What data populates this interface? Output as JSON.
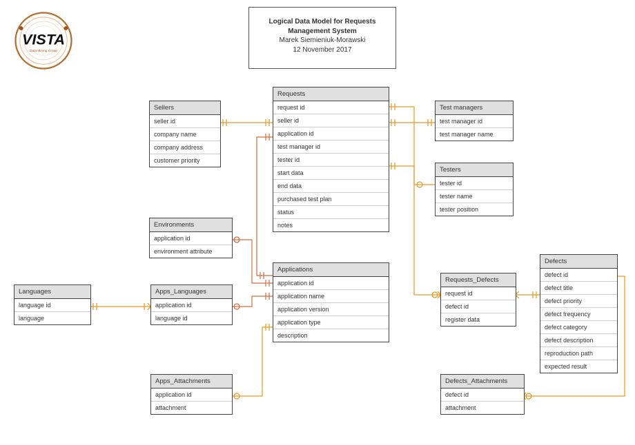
{
  "title": {
    "line1": "Logical Data Model for Requests",
    "line2": "Management System",
    "line3": "Marek Siemieniuk-Morawski",
    "line4": "12 November 2017"
  },
  "logo": {
    "text": "VISTA",
    "sub": "Data Mining Group"
  },
  "entities": {
    "sellers": {
      "name": "Sellers",
      "rows": [
        "seller id",
        "company name",
        "company address",
        "customer priority"
      ]
    },
    "requests": {
      "name": "Requests",
      "rows": [
        "request id",
        "seller id",
        "application id",
        "test manager id",
        "tester id",
        "start data",
        "end data",
        "purchased test plan",
        "status",
        "notes"
      ]
    },
    "test_managers": {
      "name": "Test managers",
      "rows": [
        "test manager id",
        "test manager name"
      ]
    },
    "testers": {
      "name": "Testers",
      "rows": [
        "tester id",
        "tester name",
        "tester position"
      ]
    },
    "environments": {
      "name": "Environments",
      "rows": [
        "application id",
        "environment attribute"
      ]
    },
    "applications": {
      "name": "Applications",
      "rows": [
        "application id",
        "application name",
        "application version",
        "application type",
        "description"
      ]
    },
    "requests_defects": {
      "name": "Requests_Defects",
      "rows": [
        "request id",
        "defect id",
        "register data"
      ]
    },
    "defects": {
      "name": "Defects",
      "rows": [
        "defect id",
        "defect title",
        "defect priority",
        "defect frequency",
        "defect category",
        "defect description",
        "reproduction path",
        "expected result"
      ]
    },
    "languages": {
      "name": "Languages",
      "rows": [
        "language id",
        "language"
      ]
    },
    "apps_languages": {
      "name": "Apps_Languages",
      "rows": [
        "application id",
        "language id"
      ]
    },
    "apps_attachments": {
      "name": "Apps_Attachments",
      "rows": [
        "application id",
        "attachment"
      ]
    },
    "defects_attachments": {
      "name": "Defects_Attachments",
      "rows": [
        "defect id",
        "attachment"
      ]
    }
  },
  "relationships": [
    {
      "from": "Sellers",
      "to": "Requests",
      "via": "seller id"
    },
    {
      "from": "Applications",
      "to": "Requests",
      "via": "application id"
    },
    {
      "from": "Test managers",
      "to": "Requests",
      "via": "test manager id"
    },
    {
      "from": "Testers",
      "to": "Requests",
      "via": "tester id"
    },
    {
      "from": "Environments",
      "to": "Applications",
      "via": "application id"
    },
    {
      "from": "Apps_Languages",
      "to": "Applications",
      "via": "application id"
    },
    {
      "from": "Languages",
      "to": "Apps_Languages",
      "via": "language id"
    },
    {
      "from": "Apps_Attachments",
      "to": "Applications",
      "via": "application id"
    },
    {
      "from": "Requests",
      "to": "Requests_Defects",
      "via": "request id"
    },
    {
      "from": "Defects",
      "to": "Requests_Defects",
      "via": "defect id"
    },
    {
      "from": "Defects",
      "to": "Defects_Attachments",
      "via": "defect id"
    }
  ]
}
